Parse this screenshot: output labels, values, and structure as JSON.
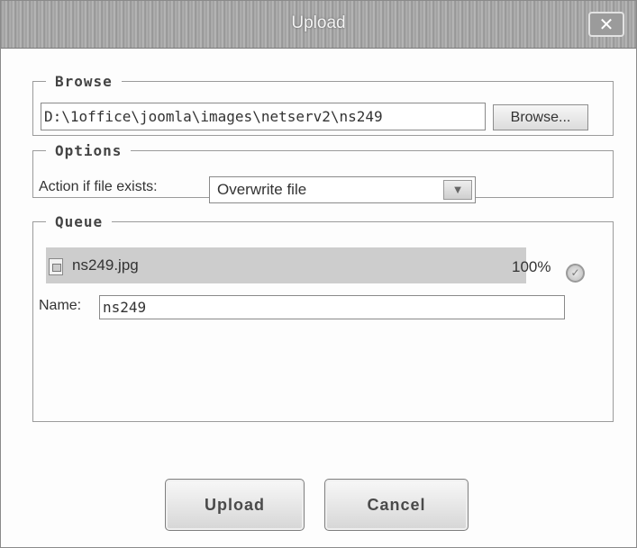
{
  "window": {
    "title": "Upload",
    "close_label": "✕"
  },
  "browse": {
    "legend": "Browse",
    "path_value": "D:\\1office\\joomla\\images\\netserv2\\ns249",
    "button_label": "Browse..."
  },
  "options": {
    "legend": "Options",
    "action_label": "Action if file exists:",
    "action_selected": "Overwrite file"
  },
  "queue": {
    "legend": "Queue",
    "file_name": "ns249.jpg",
    "progress_percent": 100,
    "progress_text": "100%",
    "name_label": "Name:",
    "name_value": "ns249"
  },
  "actions": {
    "upload_label": "Upload",
    "cancel_label": "Cancel"
  },
  "icons": {
    "close": "close-icon",
    "file": "file-icon",
    "done": "checkmark-icon",
    "dropdown": "chevron-down-icon"
  }
}
